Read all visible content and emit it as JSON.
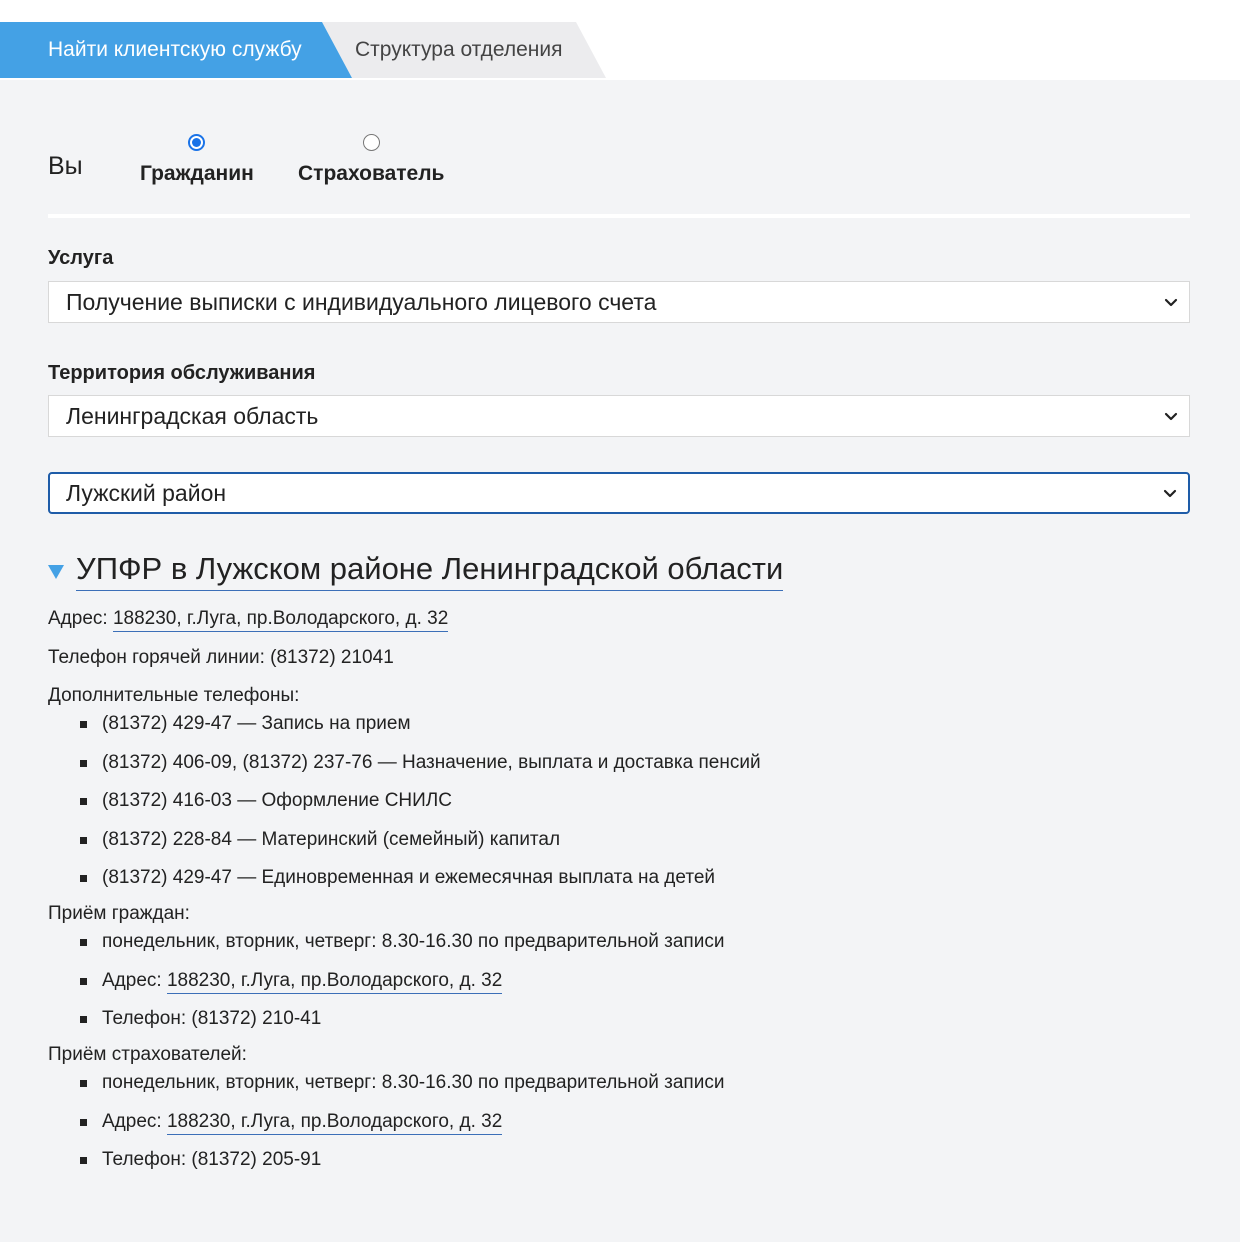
{
  "tabs": {
    "active_label": "Найти клиентскую службу",
    "inactive_label": "Структура отделения"
  },
  "you": {
    "label": "Вы",
    "options": [
      {
        "label": "Гражданин",
        "checked": true
      },
      {
        "label": "Страхователь",
        "checked": false
      }
    ]
  },
  "service": {
    "label": "Услуга",
    "selected": "Получение выписки с индивидуального лицевого счета"
  },
  "territory": {
    "label": "Территория обслуживания",
    "region_selected": "Ленинградская область",
    "district_selected": "Лужский район"
  },
  "office": {
    "title": "УПФР в Лужском районе Ленинградской области",
    "address_label": "Адрес:",
    "address": "188230, г.Луга, пр.Володарского, д. 32",
    "hotline": "Телефон горячей линии: (81372) 21041",
    "extra_phones_label": "Дополнительные телефоны:",
    "extra_phones": [
      "(81372) 429-47 — Запись на прием",
      "(81372) 406-09, (81372) 237-76 — Назначение, выплата и доставка пенсий",
      "(81372) 416-03 — Оформление СНИЛС",
      "(81372) 228-84 — Материнский (семейный) капитал",
      "(81372) 429-47 — Единовременная и ежемесячная выплата на детей"
    ],
    "citizens": {
      "label": "Приём граждан:",
      "hours": "понедельник, вторник, четверг: 8.30-16.30 по предварительной записи",
      "address_label": "Адрес:",
      "address": "188230, г.Луга, пр.Володарского, д. 32",
      "phone": "Телефон: (81372) 210-41"
    },
    "insurers": {
      "label": "Приём страхователей:",
      "hours": "понедельник, вторник, четверг: 8.30-16.30 по предварительной записи",
      "address_label": "Адрес:",
      "address": "188230, г.Луга, пр.Володарского, д. 32",
      "phone": "Телефон: (81372) 205-91"
    }
  },
  "colors": {
    "tab_active": "#44a1e5",
    "accent_link_underline": "#3b6fb8",
    "radio_checked": "#1a73e8",
    "background": "#f3f4f6"
  }
}
